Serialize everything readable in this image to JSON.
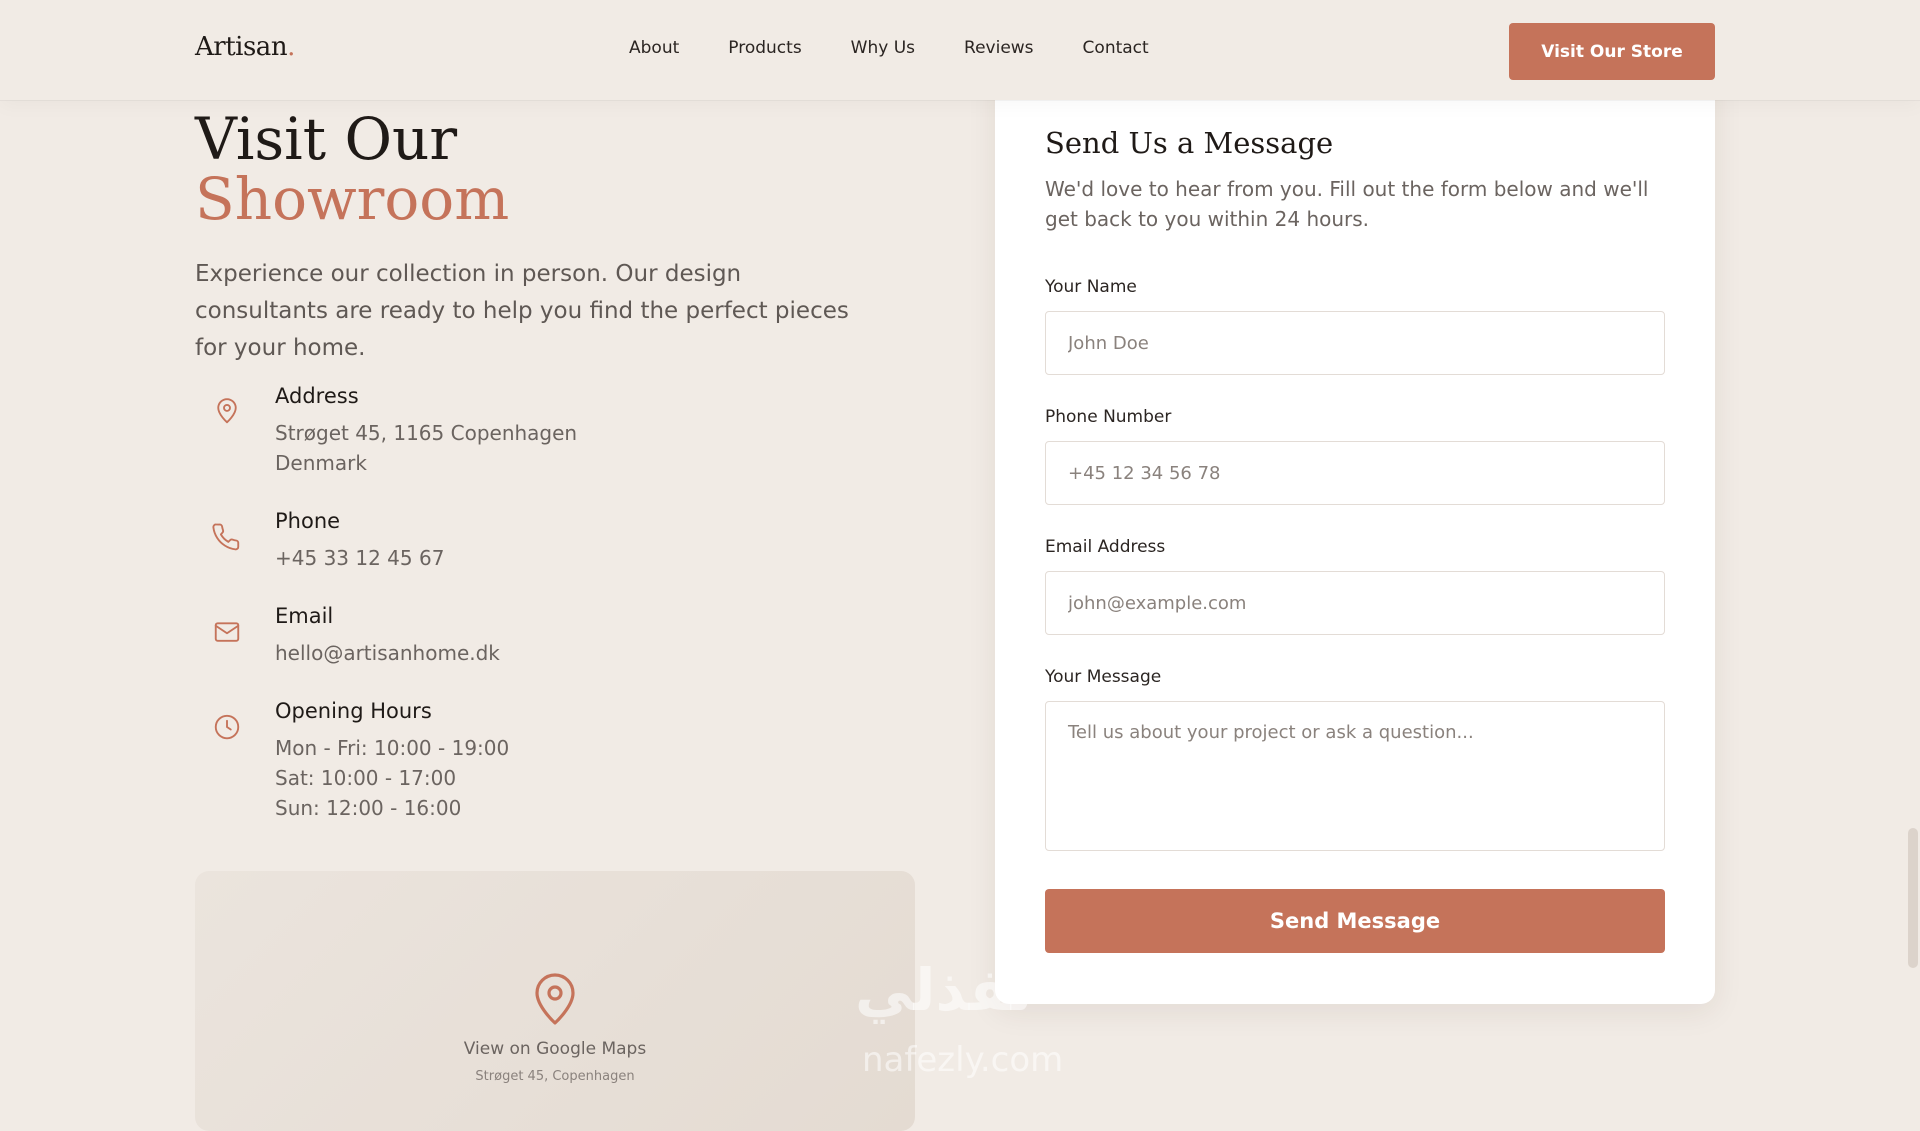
{
  "header": {
    "logo": "Artisan",
    "logo_dot": ".",
    "nav": [
      "About",
      "Products",
      "Why Us",
      "Reviews",
      "Contact"
    ],
    "store_button": "Visit Our Store"
  },
  "hero": {
    "title_line1": "Visit Our",
    "title_line2": "Showroom",
    "intro": "Experience our collection in person. Our design consultants are ready to help you find the perfect pieces for your home."
  },
  "info": {
    "address": {
      "icon": "map-pin-icon",
      "title": "Address",
      "lines": [
        "Strøget 45, 1165 Copenhagen",
        "Denmark"
      ]
    },
    "phone": {
      "icon": "phone-icon",
      "title": "Phone",
      "lines": [
        "+45 33 12 45 67"
      ]
    },
    "email": {
      "icon": "mail-icon",
      "title": "Email",
      "lines": [
        "hello@artisanhome.dk"
      ]
    },
    "hours": {
      "icon": "clock-icon",
      "title": "Opening Hours",
      "lines": [
        "Mon - Fri: 10:00 - 19:00",
        "Sat: 10:00 - 17:00",
        "Sun: 12:00 - 16:00"
      ]
    }
  },
  "map": {
    "link_label": "View on Google Maps",
    "sub_label": "Strøget 45, Copenhagen"
  },
  "form": {
    "title": "Send Us a Message",
    "subtitle": "We'd love to hear from you. Fill out the form below and we'll get back to you within 24 hours.",
    "name_label": "Your Name",
    "name_placeholder": "John Doe",
    "phone_label": "Phone Number",
    "phone_placeholder": "+45 12 34 56 78",
    "email_label": "Email Address",
    "email_placeholder": "john@example.com",
    "message_label": "Your Message",
    "message_placeholder": "Tell us about your project or ask a question...",
    "submit_label": "Send Message"
  },
  "watermark": {
    "text": "نفذلي",
    "sub": "nafezly.com"
  },
  "colors": {
    "accent": "#c5735a",
    "background": "#f1ebe5",
    "card": "#ffffff",
    "text_dark": "#1f1a17",
    "text_muted": "#6b6460"
  }
}
